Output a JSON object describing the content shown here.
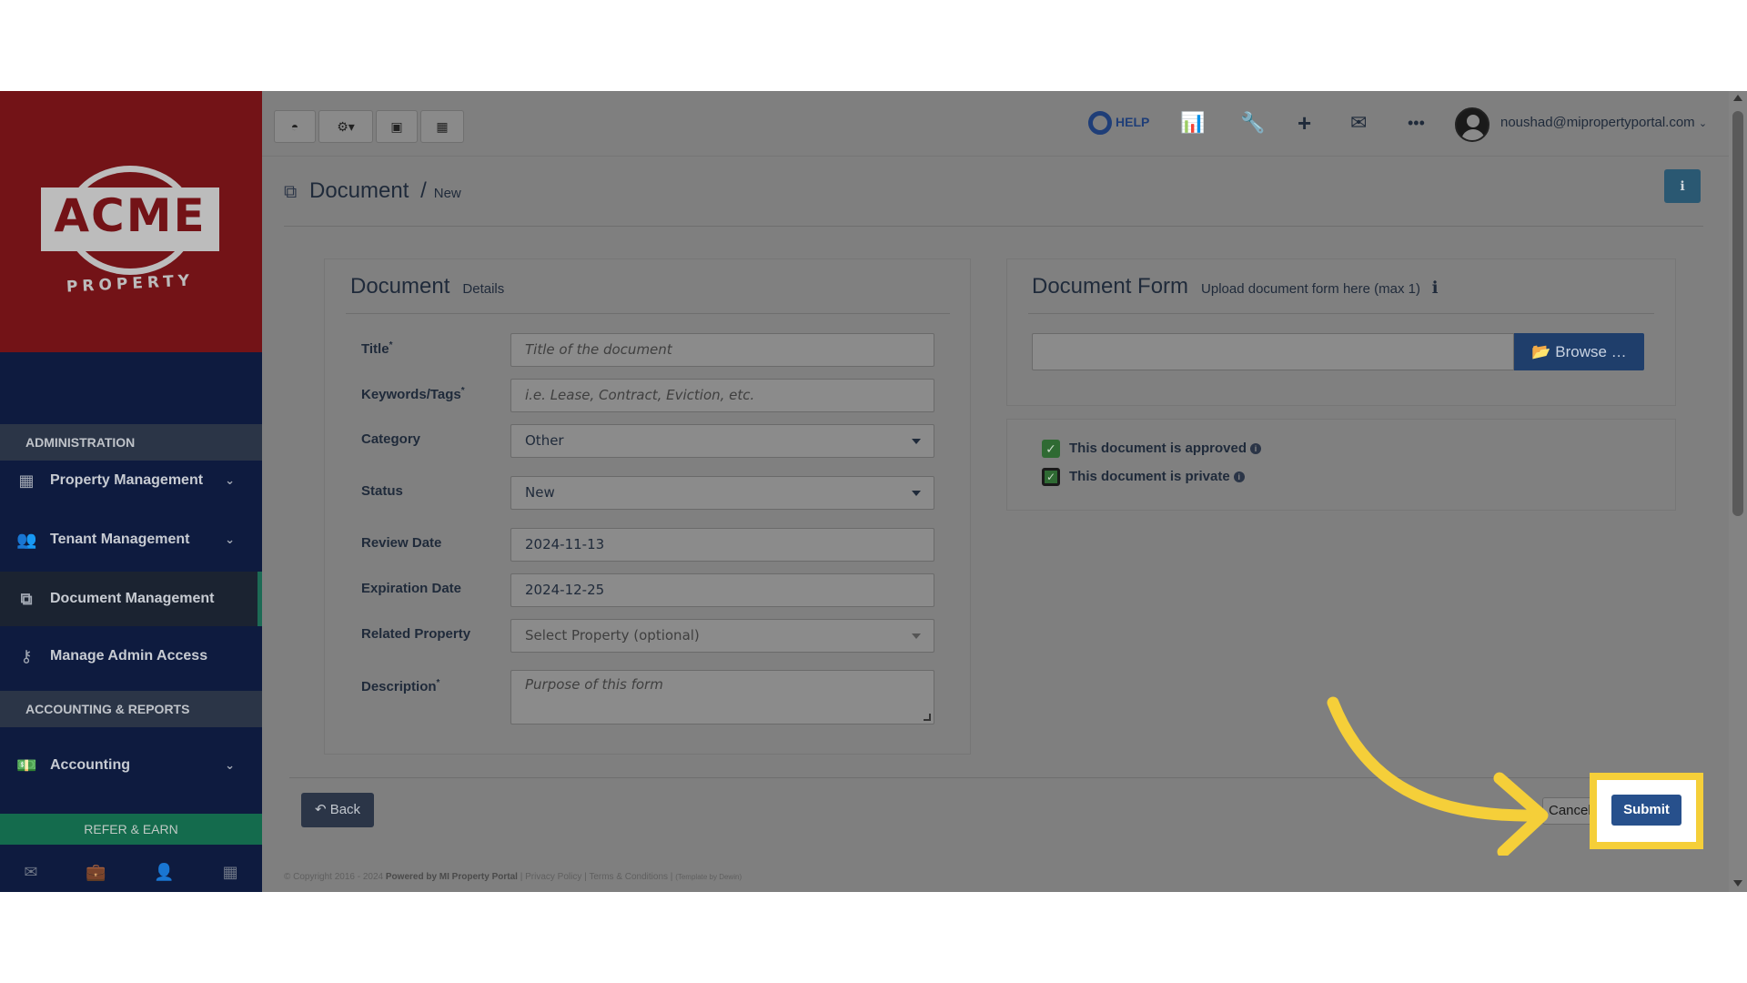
{
  "brand": {
    "logo_text": "ACME",
    "logo_sub": "PROPERTY"
  },
  "sidebar": {
    "section_admin": "ADMINISTRATION",
    "section_accounting": "ACCOUNTING & REPORTS",
    "items": [
      {
        "label": "Property Management",
        "icon": "building-icon",
        "expandable": true
      },
      {
        "label": "Tenant Management",
        "icon": "users-icon",
        "expandable": true
      },
      {
        "label": "Document Management",
        "icon": "documents-icon",
        "active": true
      },
      {
        "label": "Manage Admin Access",
        "icon": "key-icon"
      },
      {
        "label": "Accounting",
        "icon": "money-icon",
        "expandable": true
      }
    ],
    "refer_label": "REFER & EARN",
    "footer_icons": [
      "mail-icon",
      "briefcase-icon",
      "user-icon",
      "calculator-icon"
    ]
  },
  "topbar": {
    "left_buttons": [
      "dashboard-icon",
      "settings-dropdown-icon",
      "calendar-icon",
      "calculator-icon"
    ],
    "help_label": "HELP",
    "right_icons": [
      "bar-chart-icon",
      "wrench-icon",
      "plus-icon",
      "envelope-icon",
      "more-icon"
    ],
    "user_email": "noushad@mipropertyportal.com"
  },
  "page": {
    "title": "Document",
    "separator": "/",
    "subtitle": "New"
  },
  "details_panel": {
    "title": "Document",
    "subtitle": "Details",
    "fields": {
      "title": {
        "label": "Title",
        "required": "*",
        "placeholder": "Title of the document",
        "value": ""
      },
      "keywords": {
        "label": "Keywords/Tags",
        "required": "*",
        "placeholder": "i.e. Lease, Contract, Eviction, etc.",
        "value": ""
      },
      "category": {
        "label": "Category",
        "value": "Other"
      },
      "status": {
        "label": "Status",
        "value": "New"
      },
      "review_date": {
        "label": "Review Date",
        "value": "2024-11-13"
      },
      "expiration_date": {
        "label": "Expiration Date",
        "value": "2024-12-25"
      },
      "related_property": {
        "label": "Related Property",
        "placeholder": "Select Property (optional)"
      },
      "description": {
        "label": "Description",
        "required": "*",
        "placeholder": "Purpose of this form",
        "value": ""
      }
    }
  },
  "form_panel": {
    "title": "Document Form",
    "subtitle": "Upload document form here (max 1)",
    "browse_label": "Browse …"
  },
  "options": {
    "approved_label": "This document is approved",
    "approved_checked": true,
    "private_label": "This document is private",
    "private_checked": true
  },
  "actions": {
    "back_label": "Back",
    "cancel_label": "Cancel",
    "submit_label": "Submit"
  },
  "footer": {
    "copyright": "© Copyright 2016 - 2024",
    "powered": "Powered by MI Property Portal",
    "privacy": "Privacy Policy",
    "terms": "Terms & Conditions",
    "theme": "(Template by Dewin)"
  },
  "colors": {
    "highlight": "#f5cf39",
    "submit": "#27508c",
    "brand_red": "#731317",
    "sidebar": "#0e1b3f"
  }
}
